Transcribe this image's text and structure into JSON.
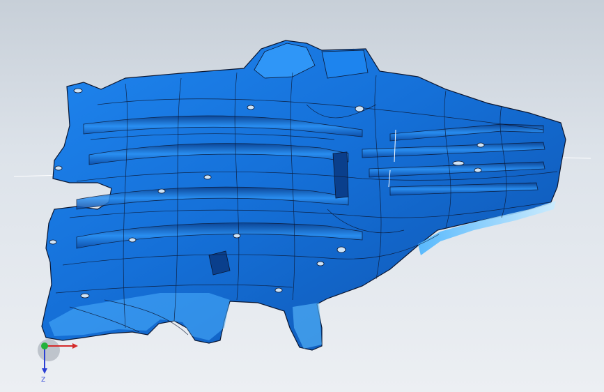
{
  "viewport": {
    "background_top": "#c7cfd8",
    "background_bottom": "#eceff3"
  },
  "part": {
    "fill_color": "#1a78e6",
    "dark_color": "#0a3f8c",
    "highlight_color": "#8fd0ff",
    "edge_color": "#0b1630"
  },
  "triad": {
    "x_label": "",
    "y_label": "",
    "z_label": "Z",
    "x_color": "#d42a2a",
    "y_color": "#23b23a",
    "z_color": "#2a3fd4"
  }
}
